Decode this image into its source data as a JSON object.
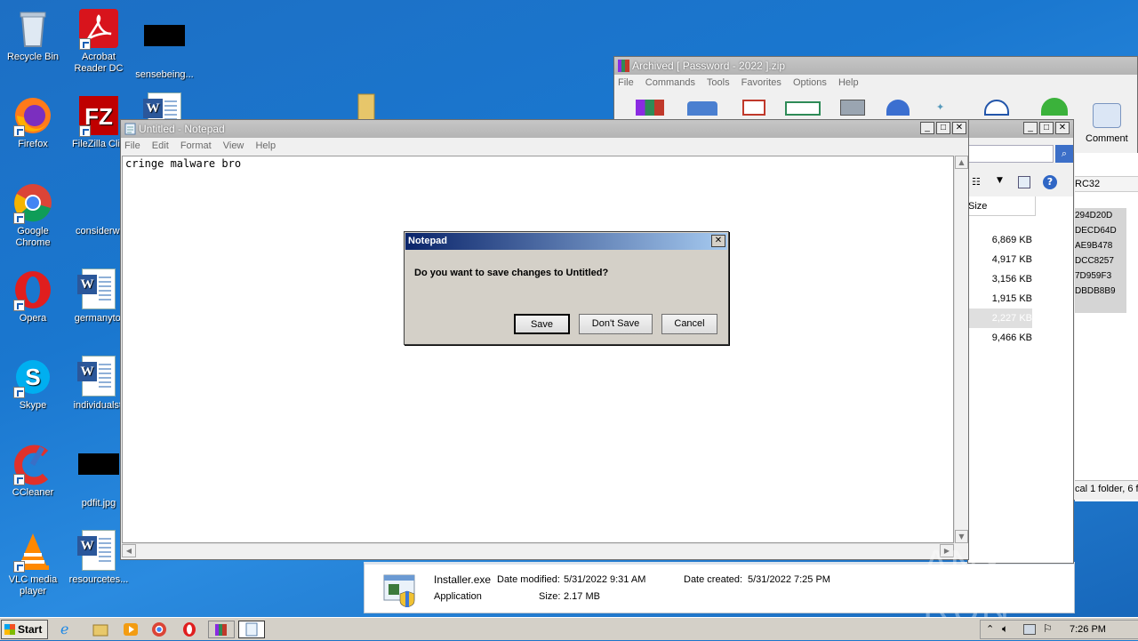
{
  "desktop": {
    "icons": [
      {
        "label": "Recycle Bin"
      },
      {
        "label": "Acrobat Reader DC"
      },
      {
        "label": "sensebeing..."
      },
      {
        "label": "Firefox"
      },
      {
        "label": "FileZilla Clie"
      },
      {
        "label": "Google Chrome"
      },
      {
        "label": "considerwi"
      },
      {
        "label": "Opera"
      },
      {
        "label": "germanytol"
      },
      {
        "label": "Skype"
      },
      {
        "label": "individualsti"
      },
      {
        "label": "CCleaner"
      },
      {
        "label": "pdfit.jpg"
      },
      {
        "label": "VLC media player"
      },
      {
        "label": "resourcetes..."
      }
    ]
  },
  "winrar": {
    "title": "Archived [ Password - 2022 ].zip",
    "menu": [
      "File",
      "Commands",
      "Tools",
      "Favorites",
      "Options",
      "Help"
    ],
    "toolbar_comment": "Comment",
    "column_size": "Size",
    "column_crc": "RC32",
    "sizes": [
      "6,869 KB",
      "4,917 KB",
      "3,156 KB",
      "1,915 KB",
      "2,227 KB",
      "9,466 KB"
    ],
    "crcs": [
      "294D20D",
      "DECD64D",
      "AE9B478",
      "DCC8257",
      "7D959F3",
      "DBDB8B9"
    ],
    "status": "cal 1 folder, 6 fi"
  },
  "explorer_details": {
    "name": "Installer.exe",
    "modified_label": "Date modified:",
    "modified_value": "5/31/2022 9:31 AM",
    "created_label": "Date created:",
    "created_value": "5/31/2022 7:25 PM",
    "type": "Application",
    "size_label": "Size:",
    "size_value": "2.17 MB"
  },
  "notepad": {
    "title": "Untitled - Notepad",
    "menu": [
      "File",
      "Edit",
      "Format",
      "View",
      "Help"
    ],
    "text": "cringe malware bro"
  },
  "dialog": {
    "title": "Notepad",
    "message": "Do you want to save changes to Untitled?",
    "save": "Save",
    "dont_save": "Don't Save",
    "cancel": "Cancel"
  },
  "taskbar": {
    "start": "Start",
    "clock": "7:26 PM"
  },
  "watermark": "ANY RUN"
}
